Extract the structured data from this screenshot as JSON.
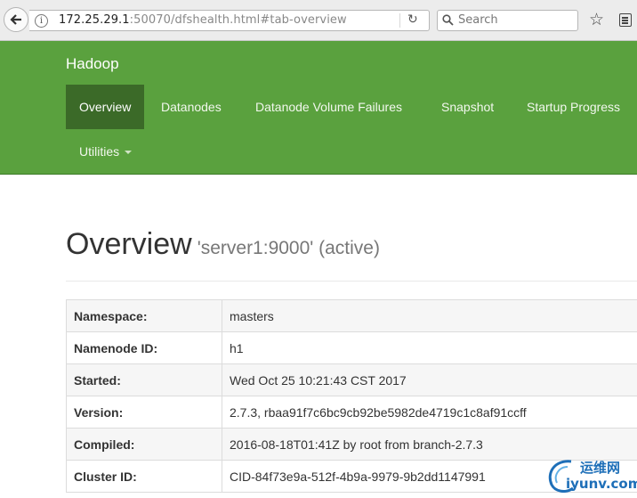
{
  "browser": {
    "url_host": "172.25.29.1",
    "url_rest": ":50070/dfshealth.html#tab-overview",
    "search_placeholder": "Search"
  },
  "navbar": {
    "brand": "Hadoop",
    "items": [
      {
        "label": "Overview",
        "active": true
      },
      {
        "label": "Datanodes"
      },
      {
        "label": "Datanode Volume Failures"
      },
      {
        "label": "Snapshot"
      },
      {
        "label": "Startup Progress"
      },
      {
        "label": "Utilities"
      }
    ]
  },
  "page": {
    "title": "Overview",
    "subtitle": "'server1:9000' (active)"
  },
  "info_table": [
    {
      "key": "Namespace:",
      "value": "masters"
    },
    {
      "key": "Namenode ID:",
      "value": "h1"
    },
    {
      "key": "Started:",
      "value": "Wed Oct 25 10:21:43 CST 2017"
    },
    {
      "key": "Version:",
      "value": "2.7.3, rbaa91f7c6bc9cb92be5982de4719c1c8af91ccff"
    },
    {
      "key": "Compiled:",
      "value": "2016-08-18T01:41Z by root from branch-2.7.3"
    },
    {
      "key": "Cluster ID:",
      "value": "CID-84f73e9a-512f-4b9a-9979-9b2dd1147991"
    }
  ],
  "watermark": {
    "line1": "运维网",
    "line2": "iyunv.com"
  }
}
